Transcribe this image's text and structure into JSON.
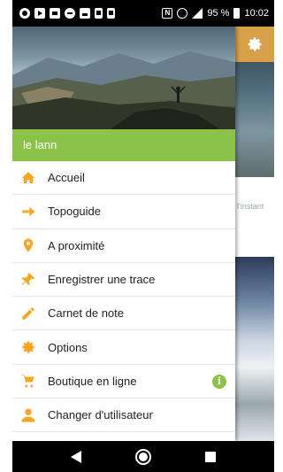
{
  "status_bar": {
    "icons": [
      "notification-icon",
      "youtube-icon",
      "mail-icon",
      "minus-circle-icon",
      "image-icon",
      "download-icon",
      "download-icon",
      "nfc-icon",
      "alarm-icon",
      "signal-icon",
      "battery-icon"
    ],
    "nfc_label": "N",
    "battery_percent": "95 %",
    "time": "10:02"
  },
  "background": {
    "partial_text": "l'instant",
    "accent_color": "#d9a04a"
  },
  "drawer": {
    "username": "le lann",
    "accent_color": "#8bc34a",
    "icon_color": "#f5a623",
    "items": [
      {
        "label": "Accueil",
        "icon": "home-icon"
      },
      {
        "label": "Topoguide",
        "icon": "arrow-right-icon"
      },
      {
        "label": "A proximité",
        "icon": "map-pin-icon"
      },
      {
        "label": "Enregistrer une trace",
        "icon": "push-pin-icon"
      },
      {
        "label": "Carnet de note",
        "icon": "pencil-icon"
      },
      {
        "label": "Options",
        "icon": "gear-icon"
      },
      {
        "label": "Boutique en ligne",
        "icon": "cart-icon",
        "badge": "i"
      },
      {
        "label": "Changer d'utilisateur",
        "icon": "user-icon"
      }
    ]
  },
  "nav_bar": {
    "icons": [
      "back-icon",
      "home-icon",
      "recent-apps-icon"
    ]
  }
}
